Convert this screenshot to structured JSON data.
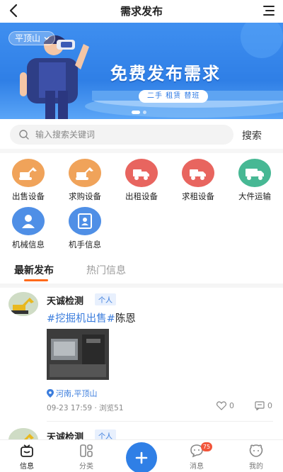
{
  "header": {
    "title": "需求发布",
    "back_icon": "back-arrow-icon",
    "menu_icon": "menu-icon"
  },
  "banner": {
    "city": "平顶山",
    "title": "免费发布需求",
    "subtitle": "二手  租赁  替班",
    "slide_count": 2,
    "active_slide": 1
  },
  "search": {
    "placeholder": "输入搜索关键词",
    "button": "搜索"
  },
  "categories": [
    {
      "label": "出售设备",
      "icon": "excavator-icon",
      "color": "#f0a35a"
    },
    {
      "label": "求购设备",
      "icon": "excavator-icon",
      "color": "#f0a35a"
    },
    {
      "label": "出租设备",
      "icon": "truck-icon",
      "color": "#e8655f"
    },
    {
      "label": "求租设备",
      "icon": "truck-icon",
      "color": "#e8655f"
    },
    {
      "label": "大件运输",
      "icon": "transport-truck-icon",
      "color": "#47b894"
    },
    {
      "label": "机械信息",
      "icon": "person-icon",
      "color": "#4f8fe6"
    },
    {
      "label": "机手信息",
      "icon": "id-card-icon",
      "color": "#4f8fe6"
    }
  ],
  "tabs": {
    "latest": "最新发布",
    "hot": "热门信息"
  },
  "posts": [
    {
      "user": "天诚检测",
      "badge": "个人",
      "title_tag": "#挖掘机出售#",
      "title_rest": "陈恩",
      "location": "河南,平顶山",
      "time": "09-23 17:59",
      "views": "浏览51",
      "likes": "0",
      "comments": "0"
    },
    {
      "user": "天诚检测",
      "badge": "个人"
    }
  ],
  "tabbar": {
    "items": [
      {
        "label": "信息",
        "icon": "message-box-icon"
      },
      {
        "label": "分类",
        "icon": "category-icon"
      },
      {
        "label": "消息",
        "icon": "chat-icon"
      },
      {
        "label": "我的",
        "icon": "profile-icon"
      }
    ],
    "publish_icon": "plus-icon",
    "message_badge": "75"
  },
  "colors": {
    "accent": "#2f7fe6",
    "tab_underline": "#ff6a1a",
    "link": "#3b7ddd",
    "badge": "#f2553a"
  }
}
